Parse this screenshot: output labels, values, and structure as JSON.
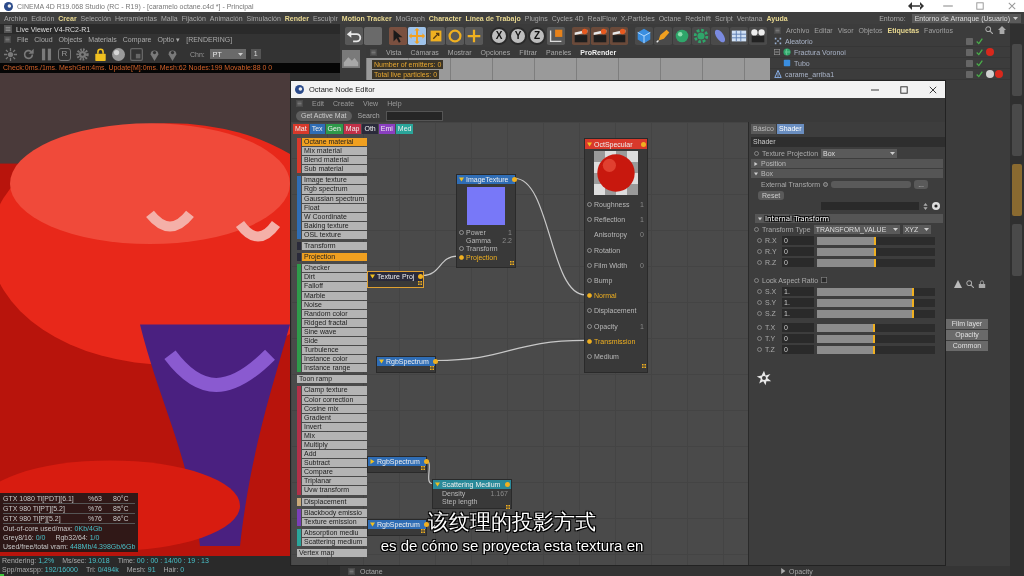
{
  "window": {
    "title": "CINEMA 4D R19.068 Studio (RC - R19) - [caramelo octane.c4d *] - Principal"
  },
  "menu_bar": {
    "items": [
      {
        "label": "Archivo",
        "highlighted": false
      },
      {
        "label": "Edición",
        "highlighted": false
      },
      {
        "label": "Crear",
        "highlighted": true
      },
      {
        "label": "Selección",
        "highlighted": false
      },
      {
        "label": "Herramientas",
        "highlighted": false
      },
      {
        "label": "Malla",
        "highlighted": false
      },
      {
        "label": "Fijación",
        "highlighted": false
      },
      {
        "label": "Animación",
        "highlighted": false
      },
      {
        "label": "Simulación",
        "highlighted": false
      },
      {
        "label": "Render",
        "highlighted": true
      },
      {
        "label": "Esculpir",
        "highlighted": false
      },
      {
        "label": "Motion Tracker",
        "highlighted": true
      },
      {
        "label": "MoGraph",
        "highlighted": false
      },
      {
        "label": "Character",
        "highlighted": true
      },
      {
        "label": "Línea de Trabajo",
        "highlighted": true
      },
      {
        "label": "Plugins",
        "highlighted": false
      },
      {
        "label": "Cycles 4D",
        "highlighted": false
      },
      {
        "label": "RealFlow",
        "highlighted": false
      },
      {
        "label": "X-Particles",
        "highlighted": false
      },
      {
        "label": "Octane",
        "highlighted": false
      },
      {
        "label": "Redshift",
        "highlighted": false
      },
      {
        "label": "Script",
        "highlighted": false
      },
      {
        "label": "Ventana",
        "highlighted": false
      },
      {
        "label": "Ayuda",
        "highlighted": true
      }
    ],
    "environment_label": "Entorno:",
    "environment_value": "Entorno de Arranque (Usuario)"
  },
  "live_viewer": {
    "title": "Live Viewer V4-RC2-R1",
    "menu": [
      "File",
      "Cloud",
      "Objects",
      "Materials",
      "Compare",
      "Optio ▾"
    ],
    "render_state": "[RENDERING]",
    "region_button": "R",
    "channel_label": "Chn:",
    "channel_value": "PT",
    "channel_count": "1",
    "log": "Check:0ms./1ms. MeshGen:4ms. Update[M]:0ms. Mesh:62 Nodes:199 Movable:88 0 0",
    "gpus": [
      {
        "name": "GTX 1080 Ti[PDT][6.1]",
        "load": "%63",
        "temp": "80°C"
      },
      {
        "name": "GTX 980 Ti[PT][5.2]",
        "load": "%76",
        "temp": "85°C"
      },
      {
        "name": "GTX 980 Ti[P][5.2]",
        "load": "%76",
        "temp": "86°C"
      }
    ],
    "memory_rows": [
      {
        "items": [
          {
            "label": "Out-of-core used/max:",
            "value": "0Kb/4Gb"
          }
        ]
      },
      {
        "items": [
          {
            "label": "Grey8/16:",
            "value": "0/0"
          },
          {
            "label": "Rgb32/64:",
            "value": "1/0"
          }
        ]
      },
      {
        "items": [
          {
            "label": "Used/free/total vram:",
            "value": "448Mb/4.398Gb/6Gb"
          }
        ]
      }
    ],
    "status": [
      {
        "label": "Rendering:",
        "value": "1,2%"
      },
      {
        "label": "Ms/sec:",
        "value": "19.018"
      },
      {
        "label": "Time:",
        "value": "00 : 00 : 14/00 : 19 : 13"
      },
      {
        "label": "Spp/maxspp:",
        "value": "192/16000"
      },
      {
        "label": "Tri:",
        "value": "0/494k"
      },
      {
        "label": "Mesh:",
        "value": "91"
      },
      {
        "label": "Hair:",
        "value": "0"
      }
    ],
    "progress": {
      "level": 0.012
    }
  },
  "main_toolbar": {
    "axis_buttons": [
      "X",
      "Y",
      "Z"
    ]
  },
  "viewport": {
    "menu": [
      {
        "label": "Vista",
        "highlighted": false
      },
      {
        "label": "Cámaras",
        "highlighted": false
      },
      {
        "label": "Mostrar",
        "highlighted": false
      },
      {
        "label": "Opciones",
        "highlighted": false
      },
      {
        "label": "Filtrar",
        "highlighted": false
      },
      {
        "label": "Paneles",
        "highlighted": false
      },
      {
        "label": "ProRender",
        "highlighted": true
      }
    ],
    "overlay": [
      "Number of emitters: 0",
      "Total live particles: 0"
    ]
  },
  "object_manager": {
    "menu": [
      {
        "label": "Archivo",
        "highlighted": false
      },
      {
        "label": "Editar",
        "highlighted": false
      },
      {
        "label": "Visor",
        "highlighted": false
      },
      {
        "label": "Objetos",
        "highlighted": false
      },
      {
        "label": "Etiquetas",
        "highlighted": true
      },
      {
        "label": "Favoritos",
        "highlighted": false
      }
    ],
    "objects": [
      {
        "name": "Aleatorio",
        "kind": "effector"
      },
      {
        "name": "Fractura Voronoi",
        "kind": "fracture",
        "expanded": true,
        "tags": [
          {
            "color": "#d8281c"
          }
        ],
        "children": [
          {
            "name": "Tubo",
            "kind": "primitive"
          }
        ]
      },
      {
        "name": "carame_arriba1",
        "kind": "group",
        "tags": [
          {
            "color": "#d0d0d0"
          },
          {
            "color": "#d8281c"
          }
        ]
      }
    ]
  },
  "layer_panel": {
    "items": [
      "Film layer",
      "Opacity",
      "Common"
    ]
  },
  "side_tabs": [
    {
      "selected": false
    },
    {
      "selected": false
    },
    {
      "selected": true
    },
    {
      "selected": false
    }
  ],
  "bottom_bar": {
    "panel_tab": "Octane",
    "attribute": "Opacity"
  },
  "node_editor": {
    "title": "Octane Node Editor",
    "menu": [
      "Edit",
      "Create",
      "View",
      "Help"
    ],
    "get_button": "Get Active Mat",
    "search_label": "Search",
    "categories": [
      {
        "label": "Mat",
        "color": "#d8392b"
      },
      {
        "label": "Tex",
        "color": "#2f6db5"
      },
      {
        "label": "Gen",
        "color": "#2e9a4a"
      },
      {
        "label": "Map",
        "color": "#c23048"
      },
      {
        "label": "Oth",
        "color": "#2a2a3a"
      },
      {
        "label": "Emi",
        "color": "#8a3fc0"
      },
      {
        "label": "Med",
        "color": "#2aa59a"
      }
    ],
    "node_groups": [
      {
        "color": "#d8392b",
        "items": [
          {
            "label": "Octane material",
            "selected": true
          },
          {
            "label": "Mix material",
            "selected": false
          },
          {
            "label": "Blend material",
            "selected": false
          },
          {
            "label": "Sub material",
            "selected": false
          }
        ]
      },
      {
        "color": "#2f6db5",
        "items": [
          {
            "label": "Image texture",
            "selected": false
          },
          {
            "label": "Rgb spectrum",
            "selected": false
          },
          {
            "label": "Gaussian spectrum",
            "selected": false
          },
          {
            "label": "Float",
            "selected": false
          },
          {
            "label": "W Coordinate",
            "selected": false
          },
          {
            "label": "Baking texture",
            "selected": false
          },
          {
            "label": "OSL texture",
            "selected": false
          }
        ]
      },
      {
        "color": "#2a2a3a",
        "items": [
          {
            "label": "Transform",
            "selected": false
          }
        ]
      },
      {
        "color": "#2a2a3a",
        "items": [
          {
            "label": "Projection",
            "selected": true
          }
        ]
      },
      {
        "color": "#2e9a4a",
        "items": [
          {
            "label": "Checker",
            "selected": false
          },
          {
            "label": "Dirt",
            "selected": false
          },
          {
            "label": "Falloff",
            "selected": false
          },
          {
            "label": "Marble",
            "selected": false
          },
          {
            "label": "Noise",
            "selected": false
          },
          {
            "label": "Random color",
            "selected": false
          },
          {
            "label": "Ridged fractal",
            "selected": false
          },
          {
            "label": "Sine wave",
            "selected": false
          },
          {
            "label": "Side",
            "selected": false
          },
          {
            "label": "Turbulence",
            "selected": false
          },
          {
            "label": "Instance color",
            "selected": false
          },
          {
            "label": "Instance range",
            "selected": false
          }
        ]
      },
      {
        "items": [
          {
            "label": "Toon ramp",
            "selected": false
          }
        ]
      },
      {
        "color": "#b23048",
        "items": [
          {
            "label": "Clamp texture",
            "selected": false
          },
          {
            "label": "Color correction",
            "selected": false
          },
          {
            "label": "Cosine mix",
            "selected": false
          },
          {
            "label": "Gradient",
            "selected": false
          },
          {
            "label": "Invert",
            "selected": false
          },
          {
            "label": "Mix",
            "selected": false
          },
          {
            "label": "Multiply",
            "selected": false
          },
          {
            "label": "Add",
            "selected": false
          },
          {
            "label": "Subtract",
            "selected": false
          },
          {
            "label": "Compare",
            "selected": false
          },
          {
            "label": "Triplanar",
            "selected": false
          },
          {
            "label": "Uvw transform",
            "selected": false
          }
        ]
      },
      {
        "color": "#c8a878",
        "items": [
          {
            "label": "Displacement",
            "selected": false
          }
        ]
      },
      {
        "color": "#7a3fb8",
        "items": [
          {
            "label": "Blackbody emissio",
            "selected": false
          },
          {
            "label": "Texture emission",
            "selected": false
          }
        ]
      },
      {
        "color": "#2aa59a",
        "items": [
          {
            "label": "Absorption mediu",
            "selected": false
          },
          {
            "label": "Scattering medium",
            "selected": false
          }
        ]
      },
      {
        "items": [
          {
            "label": "Vertex map",
            "selected": false
          }
        ]
      }
    ],
    "nodes": [
      {
        "title": "OctSpecular",
        "kind": "material",
        "color": "#d8392b",
        "selected": false,
        "expanded": true,
        "ports": [
          {
            "label": "Roughness",
            "value": "1",
            "pin": true,
            "connected": false
          },
          {
            "label": "Reflection",
            "value": "1",
            "pin": true,
            "connected": false
          },
          {
            "label": "Anisotropy",
            "value": "0",
            "pin": false,
            "connected": false
          },
          {
            "label": "Rotation",
            "pin": true,
            "connected": false
          },
          {
            "label": "Film Width",
            "value": "0",
            "pin": true,
            "connected": false
          },
          {
            "label": "Bump",
            "pin": true,
            "connected": false
          },
          {
            "label": "Normal",
            "pin": true,
            "connected": true
          },
          {
            "label": "Displacement",
            "pin": true,
            "connected": false
          },
          {
            "label": "Opacity",
            "value": "1",
            "pin": true,
            "connected": false
          },
          {
            "label": "Transmission",
            "pin": true,
            "connected": true
          },
          {
            "label": "Medium",
            "pin": true,
            "connected": false
          }
        ]
      },
      {
        "title": "ImageTexture",
        "kind": "texture",
        "color": "#2f6db5",
        "selected": false,
        "expanded": true,
        "ports": [
          {
            "label": "Power",
            "value": "1",
            "pin": true,
            "connected": false
          },
          {
            "label": "Gamma",
            "value": "2.2",
            "pin": false,
            "connected": false
          },
          {
            "label": "Transform",
            "pin": true,
            "connected": false
          },
          {
            "label": "Projection",
            "pin": true,
            "connected": true
          }
        ]
      },
      {
        "title": "Texture Proj",
        "kind": "projection",
        "color": "#2a2a3a",
        "selected": true,
        "expanded": true
      },
      {
        "title": "RgbSpectrum",
        "kind": "spectrum",
        "color": "#2f6db5",
        "selected": false,
        "expanded": true
      },
      {
        "title": "RgbSpectrum",
        "kind": "spectrum",
        "color": "#2f6db5",
        "selected": false,
        "expanded": false
      },
      {
        "title": "Scattering Medium",
        "kind": "medium",
        "color": "#2a8a9a",
        "selected": false,
        "expanded": true,
        "ports": [
          {
            "label": "Density",
            "value": "1.167",
            "pin": false,
            "connected": false
          },
          {
            "label": "Step length",
            "pin": false,
            "connected": false
          }
        ]
      },
      {
        "title": "RgbSpectrum",
        "kind": "spectrum",
        "color": "#2f6db5",
        "selected": false,
        "expanded": true
      }
    ],
    "inspector": {
      "tabs": [
        {
          "label": "Básico",
          "selected": false
        },
        {
          "label": "Shader",
          "selected": true
        }
      ],
      "section": "Shader",
      "projection_label": "Texture Projection",
      "projection_value": "Box",
      "position": {
        "label": "Position",
        "expanded": false
      },
      "box": {
        "label": "Box",
        "expanded": true
      },
      "external_label": "External Transform",
      "browse_button": "...",
      "reset_button": "Reset",
      "internal": {
        "label": "Internal Transform",
        "expanded": true
      },
      "transform_type_label": "Transform Type",
      "transform_type_value": "TRANSFORM_VALUE",
      "axis_order": "XYZ",
      "lock_label": "Lock Aspect Ratio",
      "lock_checked": false,
      "rotation": [
        {
          "label": "R.X",
          "value": "0",
          "level": 0.5
        },
        {
          "label": "R.Y",
          "value": "0",
          "level": 0.5
        },
        {
          "label": "R.Z",
          "value": "0",
          "level": 0.5
        }
      ],
      "scale": [
        {
          "label": "S.X",
          "value": "1.",
          "level": 0.82
        },
        {
          "label": "S.Y",
          "value": "1.",
          "level": 0.82
        },
        {
          "label": "S.Z",
          "value": "1.",
          "level": 0.82
        }
      ],
      "translation": [
        {
          "label": "T.X",
          "value": "0",
          "level": 0.49
        },
        {
          "label": "T.Y",
          "value": "0",
          "level": 0.49
        },
        {
          "label": "T.Z",
          "value": "0",
          "level": 0.49
        }
      ]
    }
  },
  "subtitles": [
    "该纹理的投影方式",
    "es de cómo se proyecta esta textura en"
  ]
}
